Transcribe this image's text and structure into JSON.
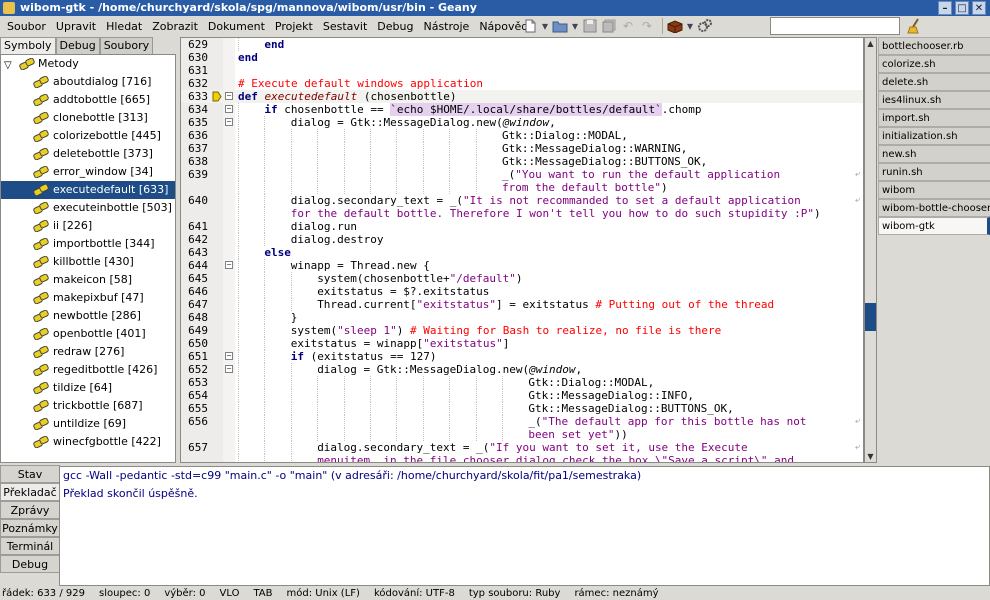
{
  "window": {
    "title": "wibom-gtk - /home/churchyard/skola/spg/mannova/wibom/usr/bin - Geany",
    "minimize_glyph": "–",
    "maximize_glyph": "□",
    "close_glyph": "✕"
  },
  "menu": [
    "Soubor",
    "Upravit",
    "Hledat",
    "Zobrazit",
    "Dokument",
    "Projekt",
    "Sestavit",
    "Debug",
    "Nástroje",
    "Nápověda"
  ],
  "toolbar": {
    "new_icon": "new-file-icon",
    "open_icon": "open-folder-icon",
    "save_icon": "save-icon",
    "save_all_icon": "save-all-icon",
    "undo_icon": "undo-icon",
    "redo_icon": "redo-icon",
    "build_icon": "build-brick-icon",
    "run_icon": "run-gears-icon",
    "search_value": "",
    "search_clear_icon": "broom-icon"
  },
  "sidebar": {
    "tabs": [
      "Symboly",
      "Debug",
      "Soubory"
    ],
    "active_tab": 0,
    "root_label": "Metody",
    "items": [
      {
        "label": "aboutdialog [716]"
      },
      {
        "label": "addtobottle [665]"
      },
      {
        "label": "clonebottle [313]"
      },
      {
        "label": "colorizebottle [445]"
      },
      {
        "label": "deletebottle [373]"
      },
      {
        "label": "error_window [34]"
      },
      {
        "label": "executedefault [633]",
        "selected": true
      },
      {
        "label": "executeinbottle [503]"
      },
      {
        "label": "ii [226]"
      },
      {
        "label": "importbottle [344]"
      },
      {
        "label": "killbottle [430]"
      },
      {
        "label": "makeicon [58]"
      },
      {
        "label": "makepixbuf [47]"
      },
      {
        "label": "newbottle [286]"
      },
      {
        "label": "openbottle [401]"
      },
      {
        "label": "redraw [276]"
      },
      {
        "label": "regeditbottle [426]"
      },
      {
        "label": "tildize [64]"
      },
      {
        "label": "trickbottle [687]"
      },
      {
        "label": "untildize [69]"
      },
      {
        "label": "winecfgbottle [422]"
      }
    ]
  },
  "editor": {
    "current_line": 633,
    "lines": [
      {
        "n": "629",
        "indent": 1,
        "parts": [
          [
            "kw",
            "end"
          ]
        ]
      },
      {
        "n": "630",
        "indent": 0,
        "parts": [
          [
            "kw",
            "end"
          ]
        ]
      },
      {
        "n": "631",
        "indent": 0,
        "parts": []
      },
      {
        "n": "632",
        "indent": 0,
        "parts": [
          [
            "cm",
            "# Execute default windows application"
          ]
        ]
      },
      {
        "n": "633",
        "indent": 0,
        "fold": "−",
        "marker": true,
        "current": true,
        "parts": [
          [
            "kw",
            "def"
          ],
          [
            "",
            " "
          ],
          [
            "ital-red",
            "executedefault"
          ],
          [
            "",
            " (chosenbottle)"
          ]
        ]
      },
      {
        "n": "634",
        "indent": 1,
        "fold": "−",
        "parts": [
          [
            "kw",
            "if"
          ],
          [
            "",
            " chosenbottle == "
          ],
          [
            "bt",
            "`echo $HOME/.local/share/bottles/default`"
          ],
          [
            "",
            ".chomp"
          ]
        ]
      },
      {
        "n": "635",
        "indent": 2,
        "fold": "−",
        "parts": [
          [
            "",
            "dialog = Gtk::MessageDialog.new("
          ],
          [
            "ivar",
            "@window"
          ],
          [
            "",
            ","
          ]
        ]
      },
      {
        "n": "636",
        "indent": 10,
        "parts": [
          [
            "",
            "Gtk::Dialog::MODAL,"
          ]
        ]
      },
      {
        "n": "637",
        "indent": 10,
        "parts": [
          [
            "",
            "Gtk::MessageDialog::WARNING,"
          ]
        ]
      },
      {
        "n": "638",
        "indent": 10,
        "parts": [
          [
            "",
            "Gtk::MessageDialog::BUTTONS_OK,"
          ]
        ]
      },
      {
        "n": "639",
        "indent": 10,
        "wrap": true,
        "parts": [
          [
            "",
            "_("
          ],
          [
            "str",
            "\"You want to run the default application"
          ]
        ]
      },
      {
        "n": "",
        "indent": 10,
        "cont": true,
        "parts": [
          [
            "str",
            "from the default bottle\""
          ],
          [
            "",
            ")"
          ]
        ]
      },
      {
        "n": "640",
        "indent": 2,
        "wrap": true,
        "parts": [
          [
            "",
            "dialog.secondary_text = _("
          ],
          [
            "str",
            "\"It is not recommanded to set a default application"
          ]
        ]
      },
      {
        "n": "",
        "indent": 2,
        "cont": true,
        "parts": [
          [
            "str",
            "for the default bottle. Therefore I won't tell you how to do such stupidity :P\""
          ],
          [
            "",
            ")"
          ]
        ]
      },
      {
        "n": "641",
        "indent": 2,
        "parts": [
          [
            "",
            "dialog.run"
          ]
        ]
      },
      {
        "n": "642",
        "indent": 2,
        "parts": [
          [
            "",
            "dialog.destroy"
          ]
        ]
      },
      {
        "n": "643",
        "indent": 1,
        "parts": [
          [
            "kw",
            "else"
          ]
        ]
      },
      {
        "n": "644",
        "indent": 2,
        "fold": "−",
        "parts": [
          [
            "",
            "winapp = Thread.new {"
          ]
        ]
      },
      {
        "n": "645",
        "indent": 3,
        "parts": [
          [
            "",
            "system(chosenbottle+"
          ],
          [
            "str",
            "\"/default\""
          ],
          [
            "",
            ")"
          ]
        ]
      },
      {
        "n": "646",
        "indent": 3,
        "parts": [
          [
            "",
            "exitstatus = $?.exitstatus"
          ]
        ]
      },
      {
        "n": "647",
        "indent": 3,
        "parts": [
          [
            "",
            "Thread.current["
          ],
          [
            "str",
            "\"exitstatus\""
          ],
          [
            "",
            "] = exitstatus "
          ],
          [
            "cm",
            "# Putting out of the thread"
          ]
        ]
      },
      {
        "n": "648",
        "indent": 2,
        "parts": [
          [
            "",
            "}"
          ]
        ]
      },
      {
        "n": "649",
        "indent": 2,
        "parts": [
          [
            "",
            "system("
          ],
          [
            "str",
            "\"sleep 1\""
          ],
          [
            "",
            ") "
          ],
          [
            "cm",
            "# Waiting for Bash to realize, no file is there"
          ]
        ]
      },
      {
        "n": "650",
        "indent": 2,
        "parts": [
          [
            "",
            "exitstatus = winapp["
          ],
          [
            "str",
            "\"exitstatus\""
          ],
          [
            "",
            "]"
          ]
        ]
      },
      {
        "n": "651",
        "indent": 2,
        "fold": "−",
        "parts": [
          [
            "kw",
            "if"
          ],
          [
            "",
            " (exitstatus == 127)"
          ]
        ]
      },
      {
        "n": "652",
        "indent": 3,
        "fold": "−",
        "parts": [
          [
            "",
            "dialog = Gtk::MessageDialog.new("
          ],
          [
            "ivar",
            "@window"
          ],
          [
            "",
            ","
          ]
        ]
      },
      {
        "n": "653",
        "indent": 11,
        "parts": [
          [
            "",
            "Gtk::Dialog::MODAL,"
          ]
        ]
      },
      {
        "n": "654",
        "indent": 11,
        "parts": [
          [
            "",
            "Gtk::MessageDialog::INFO,"
          ]
        ]
      },
      {
        "n": "655",
        "indent": 11,
        "parts": [
          [
            "",
            "Gtk::MessageDialog::BUTTONS_OK,"
          ]
        ]
      },
      {
        "n": "656",
        "indent": 11,
        "wrap": true,
        "parts": [
          [
            "",
            "_("
          ],
          [
            "str",
            "\"The default app for this bottle has not"
          ]
        ]
      },
      {
        "n": "",
        "indent": 11,
        "cont": true,
        "parts": [
          [
            "str",
            "been set yet\""
          ],
          [
            "",
            "))"
          ]
        ]
      },
      {
        "n": "657",
        "indent": 3,
        "wrap": true,
        "parts": [
          [
            "",
            "dialog.secondary_text = _("
          ],
          [
            "str",
            "\"If you want to set it, use the Execute"
          ]
        ]
      },
      {
        "n": "",
        "indent": 3,
        "cont": true,
        "parts": [
          [
            "str",
            "menuitem, in the file chooser dialog check the box \\\"Save a script\\\" and"
          ]
        ]
      }
    ]
  },
  "documents": [
    {
      "label": "bottlechooser.rb"
    },
    {
      "label": "colorize.sh"
    },
    {
      "label": "delete.sh"
    },
    {
      "label": "ies4linux.sh"
    },
    {
      "label": "import.sh"
    },
    {
      "label": "initialization.sh"
    },
    {
      "label": "new.sh"
    },
    {
      "label": "runin.sh"
    },
    {
      "label": "wibom"
    },
    {
      "label": "wibom-bottle-chooser"
    },
    {
      "label": "wibom-gtk",
      "active": true
    }
  ],
  "messages": {
    "tabs": [
      "Stav",
      "Překladač",
      "Zprávy",
      "Poznámky",
      "Terminál",
      "Debug"
    ],
    "active_tab": 1,
    "lines": [
      "gcc -Wall -pedantic -std=c99 \"main.c\" -o \"main\" (v adresáři: /home/churchyard/skola/fit/pa1/semestraka)",
      "Překlad skončil úspěšně."
    ]
  },
  "status": {
    "line": "řádek: 633 / 929",
    "column": "sloupec: 0",
    "selection": "výběr: 0",
    "mode_vlo": "VLO",
    "indent": "TAB",
    "eol": "mód: Unix (LF)",
    "encoding": "kódování: UTF-8",
    "filetype": "typ souboru: Ruby",
    "scope": "rámec: neznámý"
  },
  "colors": {
    "title_bar": "#2a5ca5",
    "selection": "#1e4c86",
    "keyword": "#00007f",
    "string": "#7f007f",
    "comment": "#ff0000"
  }
}
